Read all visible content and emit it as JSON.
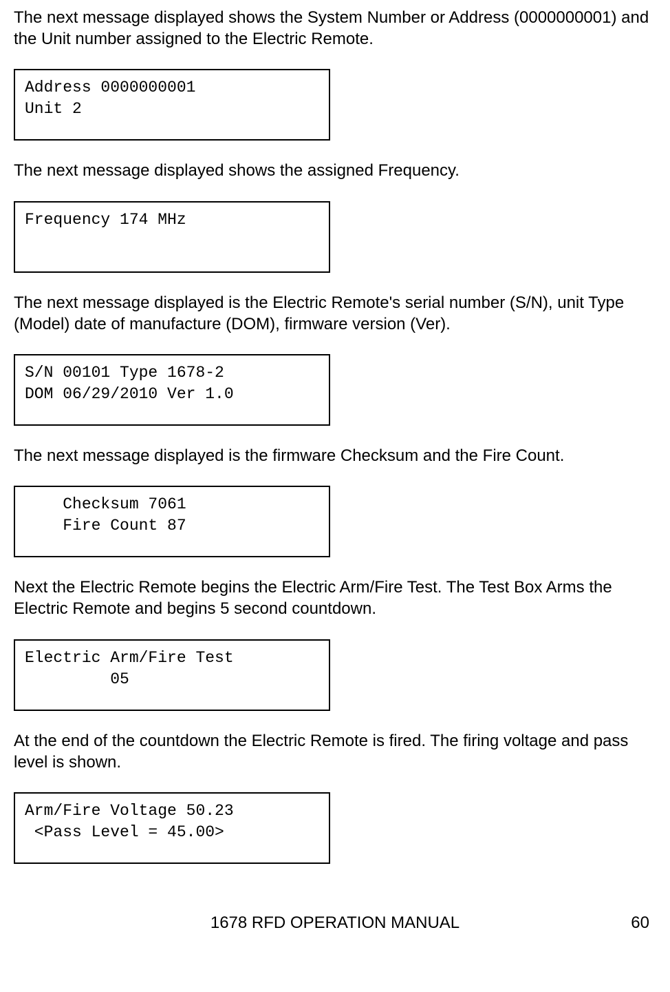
{
  "paragraphs": {
    "p1": "The next message displayed shows the System Number or Address (0000000001) and the Unit number assigned to the Electric Remote.",
    "p2": "The next message displayed shows the assigned Frequency.",
    "p3": "The next message displayed is the Electric Remote's serial number (S/N), unit Type (Model) date of manufacture (DOM), firmware version (Ver).",
    "p4": "The next message displayed is the firmware Checksum and the Fire Count.",
    "p5": "Next the Electric Remote begins the Electric Arm/Fire Test.  The Test Box Arms the Electric Remote and begins 5 second countdown.",
    "p6": "At the end of the countdown the Electric Remote is fired.  The firing voltage and pass level is shown."
  },
  "boxes": {
    "b1": {
      "line1": "Address 0000000001",
      "line2": "Unit 2"
    },
    "b2": {
      "line1": "Frequency 174 MHz",
      "line2": ""
    },
    "b3": {
      "line1": "S/N 00101 Type 1678-2",
      "line2": "DOM 06/29/2010 Ver 1.0"
    },
    "b4": {
      "line1": "    Checksum 7061",
      "line2": "    Fire Count 87"
    },
    "b5": {
      "line1": "Electric Arm/Fire Test",
      "line2": "         05"
    },
    "b6": {
      "line1": "Arm/Fire Voltage 50.23",
      "line2": " <Pass Level = 45.00>"
    }
  },
  "footer": {
    "title": "1678 RFD OPERATION MANUAL",
    "page": "60"
  }
}
